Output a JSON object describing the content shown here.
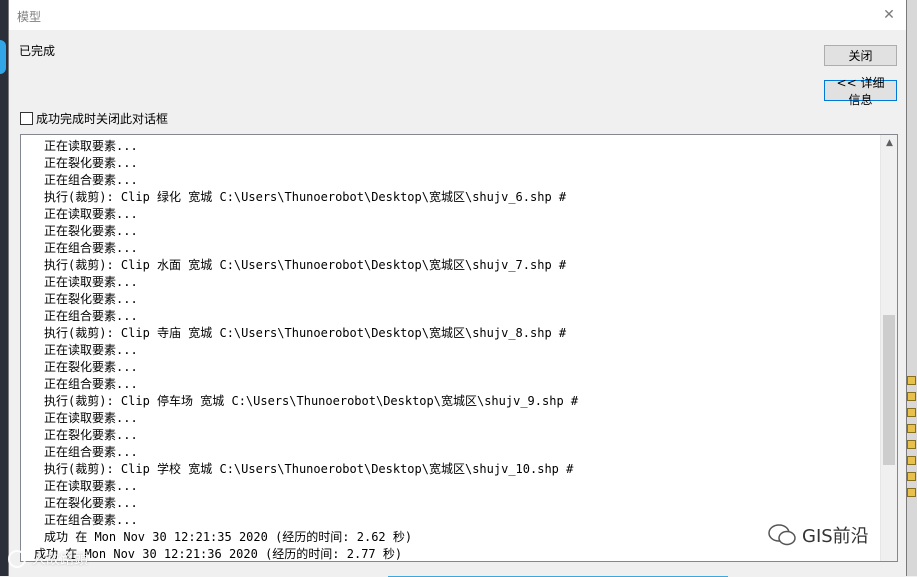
{
  "window": {
    "title": "模型"
  },
  "status": "已完成",
  "buttons": {
    "close": "关闭",
    "details": "<< 详细信息"
  },
  "checkbox": {
    "label": "成功完成时关闭此对话框",
    "checked": false
  },
  "log": {
    "lines": [
      "正在读取要素...",
      "正在裂化要素...",
      "正在组合要素...",
      "执行(裁剪): Clip 绿化 宽城 C:\\Users\\Thunoerobot\\Desktop\\宽城区\\shujv_6.shp #",
      "正在读取要素...",
      "正在裂化要素...",
      "正在组合要素...",
      "执行(裁剪): Clip 水面 宽城 C:\\Users\\Thunoerobot\\Desktop\\宽城区\\shujv_7.shp #",
      "正在读取要素...",
      "正在裂化要素...",
      "正在组合要素...",
      "执行(裁剪): Clip 寺庙 宽城 C:\\Users\\Thunoerobot\\Desktop\\宽城区\\shujv_8.shp #",
      "正在读取要素...",
      "正在裂化要素...",
      "正在组合要素...",
      "执行(裁剪): Clip 停车场 宽城 C:\\Users\\Thunoerobot\\Desktop\\宽城区\\shujv_9.shp #",
      "正在读取要素...",
      "正在裂化要素...",
      "正在组合要素...",
      "执行(裁剪): Clip 学校 宽城 C:\\Users\\Thunoerobot\\Desktop\\宽城区\\shujv_10.shp #",
      "正在读取要素...",
      "正在裂化要素...",
      "正在组合要素...",
      "成功 在 Mon Nov 30 12:21:35 2020 (经历的时间: 2.62 秒)",
      "成功 在 Mon Nov 30 12:21:36 2020 (经历的时间: 2.77 秒)"
    ],
    "indent_last_line": true
  },
  "watermarks": {
    "left": "人故路頭",
    "right": "GIS前沿"
  },
  "colors": {
    "title_text": "#808080",
    "details_border": "#0078d7"
  }
}
